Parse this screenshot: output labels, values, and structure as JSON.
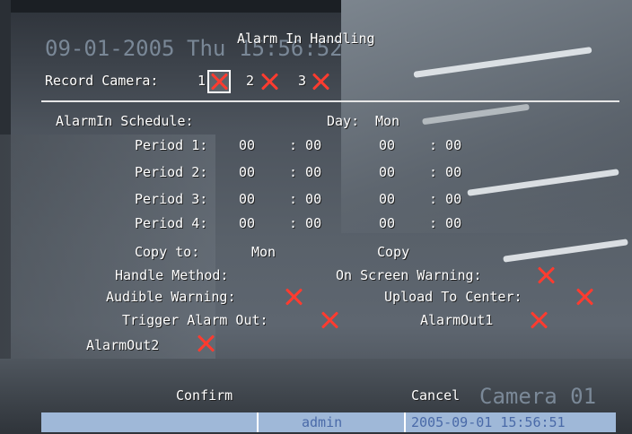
{
  "osd": {
    "date": "09-01-2005",
    "day": "Thu",
    "time": "15:56:52",
    "camera_name": "Camera 01"
  },
  "header": {
    "title": "Alarm In Handling"
  },
  "record_camera": {
    "label": "Record Camera:",
    "cameras": [
      "1",
      "2",
      "3"
    ],
    "checked": [
      true,
      true,
      true
    ]
  },
  "schedule": {
    "label": "AlarmIn Schedule:",
    "day_label": "Day:",
    "day_value": "Mon",
    "periods": [
      {
        "label": "Period 1:",
        "start_h": "00",
        "start_m": ": 00",
        "end_h": "00",
        "end_m": ": 00"
      },
      {
        "label": "Period 2:",
        "start_h": "00",
        "start_m": ": 00",
        "end_h": "00",
        "end_m": ": 00"
      },
      {
        "label": "Period 3:",
        "start_h": "00",
        "start_m": ": 00",
        "end_h": "00",
        "end_m": ": 00"
      },
      {
        "label": "Period 4:",
        "start_h": "00",
        "start_m": ": 00",
        "end_h": "00",
        "end_m": ": 00"
      }
    ],
    "copy_to_label": "Copy to:",
    "copy_to_value": "Mon",
    "copy_button": "Copy"
  },
  "handle": {
    "method_label": "Handle Method:",
    "on_screen_warning": "On Screen Warning:",
    "audible_warning": "Audible Warning:",
    "upload_to_center": "Upload To Center:",
    "trigger_alarm_out": "Trigger Alarm Out:",
    "alarm_out_1": "AlarmOut1",
    "alarm_out_2": "AlarmOut2"
  },
  "buttons": {
    "confirm": "Confirm",
    "cancel": "Cancel"
  },
  "status_bar": {
    "user": "admin",
    "datetime": "2005-09-01 15:56:51",
    "background_color": "#9fb8d8"
  },
  "colors": {
    "check_mark": "#ff3b2f",
    "text": "#ffffff"
  }
}
